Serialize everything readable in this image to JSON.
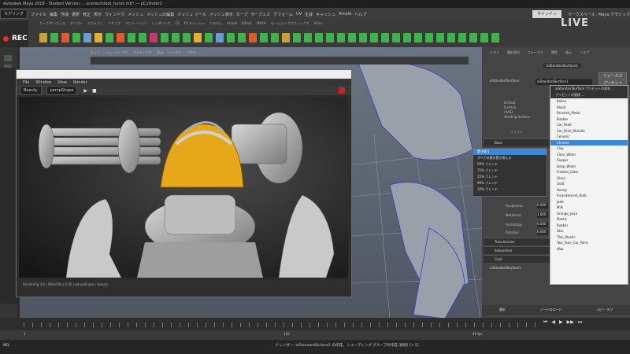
{
  "title_bar": "Autodesk Maya 2018 - Student Version: ...scenes/robot_turret.mb* --- pCylinder1",
  "menu": {
    "items": [
      "ファイル",
      "編集",
      "作成",
      "選択",
      "修正",
      "表示",
      "ウィンドウ",
      "メッシュ",
      "メッシュの編集",
      "メッシュ ツール",
      "メッシュ表示",
      "カーブ",
      "サーフェス",
      "デフォーム",
      "UV",
      "生成",
      "キャッシュ",
      "Arnold",
      "ヘルプ"
    ],
    "workspace_label": "モデリング",
    "signin_label": "サインイン",
    "workspace_right": "ワークスペース : Maya クラシック"
  },
  "rec_label": "REC",
  "live_logo": "LIVE",
  "shelf": {
    "tabs": [
      "カーブ/サーフェス",
      "ポリゴン",
      "スカルプト",
      "リギング",
      "アニメーション",
      "レンダリング",
      "FX",
      "FX キャッシュ",
      "カスタム",
      "Arnold",
      "Bifrost",
      "MASH",
      "モーション グラフィックス",
      "XGen"
    ],
    "icon_colors": [
      "#c7a13a",
      "#3db34a",
      "#e05a2b",
      "#3db34a",
      "#6b9bd1",
      "#e0b030",
      "#3db34a",
      "#e05a2b",
      "#3db34a",
      "#3db34a",
      "#c33b6e",
      "#3db34a",
      "#3db34a",
      "#3db34a",
      "#e0b030",
      "#3db34a",
      "#6b9bd1",
      "#3db34a",
      "#3db34a",
      "#e05a2b",
      "#3db34a",
      "#3db34a",
      "#c7a13a",
      "#3db34a",
      "#3db34a",
      "#3db34a",
      "#3db34a",
      "#3db34a",
      "#3db34a",
      "#3db34a",
      "#3db34a",
      "#3db34a",
      "#3db34a",
      "#3db34a",
      "#3db34a",
      "#3db34a",
      "#3db34a",
      "#3db34a",
      "#3db34a",
      "#3db34a",
      "#3db34a",
      "#3db34a"
    ]
  },
  "viewport": {
    "menu": [
      "ビュー",
      "シェーディング",
      "ライティング",
      "表示",
      "レンダラ",
      "パネル"
    ],
    "camera_label": "aiStdSurface1"
  },
  "render_view": {
    "menu": [
      "File",
      "Window",
      "View",
      "Render"
    ],
    "toolbar_mode": "Beauty",
    "toolbar_camera": "perspShape",
    "status_text": "Rendering 1/1 | 960x540 | 0.00 | perspShape | beauty"
  },
  "attribute_editor": {
    "tabs": [
      "リスト",
      "選択項目",
      "フォーカス",
      "属性",
      "表示",
      "ヘルプ"
    ],
    "node_tab": "aiStandardSurface1",
    "node_label": "aiStandardSurface:",
    "node_value": "aiStandardSurface1",
    "focus_button": "フォーカス",
    "presets_button": "プリセット",
    "sample_labels": [
      "Default",
      "Surface",
      "UVIID",
      "Shading Surface"
    ],
    "section_base": "Base",
    "weight_label": "ウェイト",
    "rows": [
      {
        "label": "Roughness",
        "value": "0.000"
      },
      {
        "label": "Metalness",
        "value": "1.000"
      },
      {
        "label": "Anisotropy",
        "value": "0.000"
      },
      {
        "label": "Rotation",
        "value": "0.000"
      }
    ],
    "sections": [
      "Transmission",
      "Subsurface",
      "Coat"
    ],
    "footer_node": "aiStandardSurface1",
    "footer_buttons": [
      "選択",
      "ノードのロード",
      "コピー タブ"
    ]
  },
  "dropdown": {
    "header": "aiStandardSurface プリセットの保存 ...\nプリセットの管理 ...",
    "items": [
      "Ballon",
      "Blood",
      "Brushed_Metal",
      "Bubble",
      "Car_Paint",
      "Car_Paint_Metallic",
      "Ceramic",
      "Chrome",
      "Clay",
      "Clear_Water",
      "Copper",
      "Deep_Water",
      "Frosted_Glass",
      "Glass",
      "Gold",
      "Honey",
      "Incandescent_Bulb",
      "Jade",
      "Milk",
      "Orange_Juice",
      "Plastic",
      "Rubber",
      "Skin",
      "Thin_Plastic",
      "Two_Tone_Car_Paint",
      "Wax"
    ],
    "selected": "Chrome"
  },
  "submenu": {
    "items": [
      "置き換え",
      "すべての値を置き換える",
      "50% ブレンド",
      "75% ブレンド",
      "25% ブレンド",
      "90% ブレンド",
      "10% ブレンド"
    ],
    "selected": "置き換え"
  },
  "timeline": {
    "frame_start": "1",
    "frame_end": "120",
    "fps_label": "24 fps"
  },
  "command_line": {
    "label": "MEL",
    "message": "// レンダー: aiStandardSurface1 の作成。 シェーディング グループの作成 (接続)  [+ 5]"
  }
}
